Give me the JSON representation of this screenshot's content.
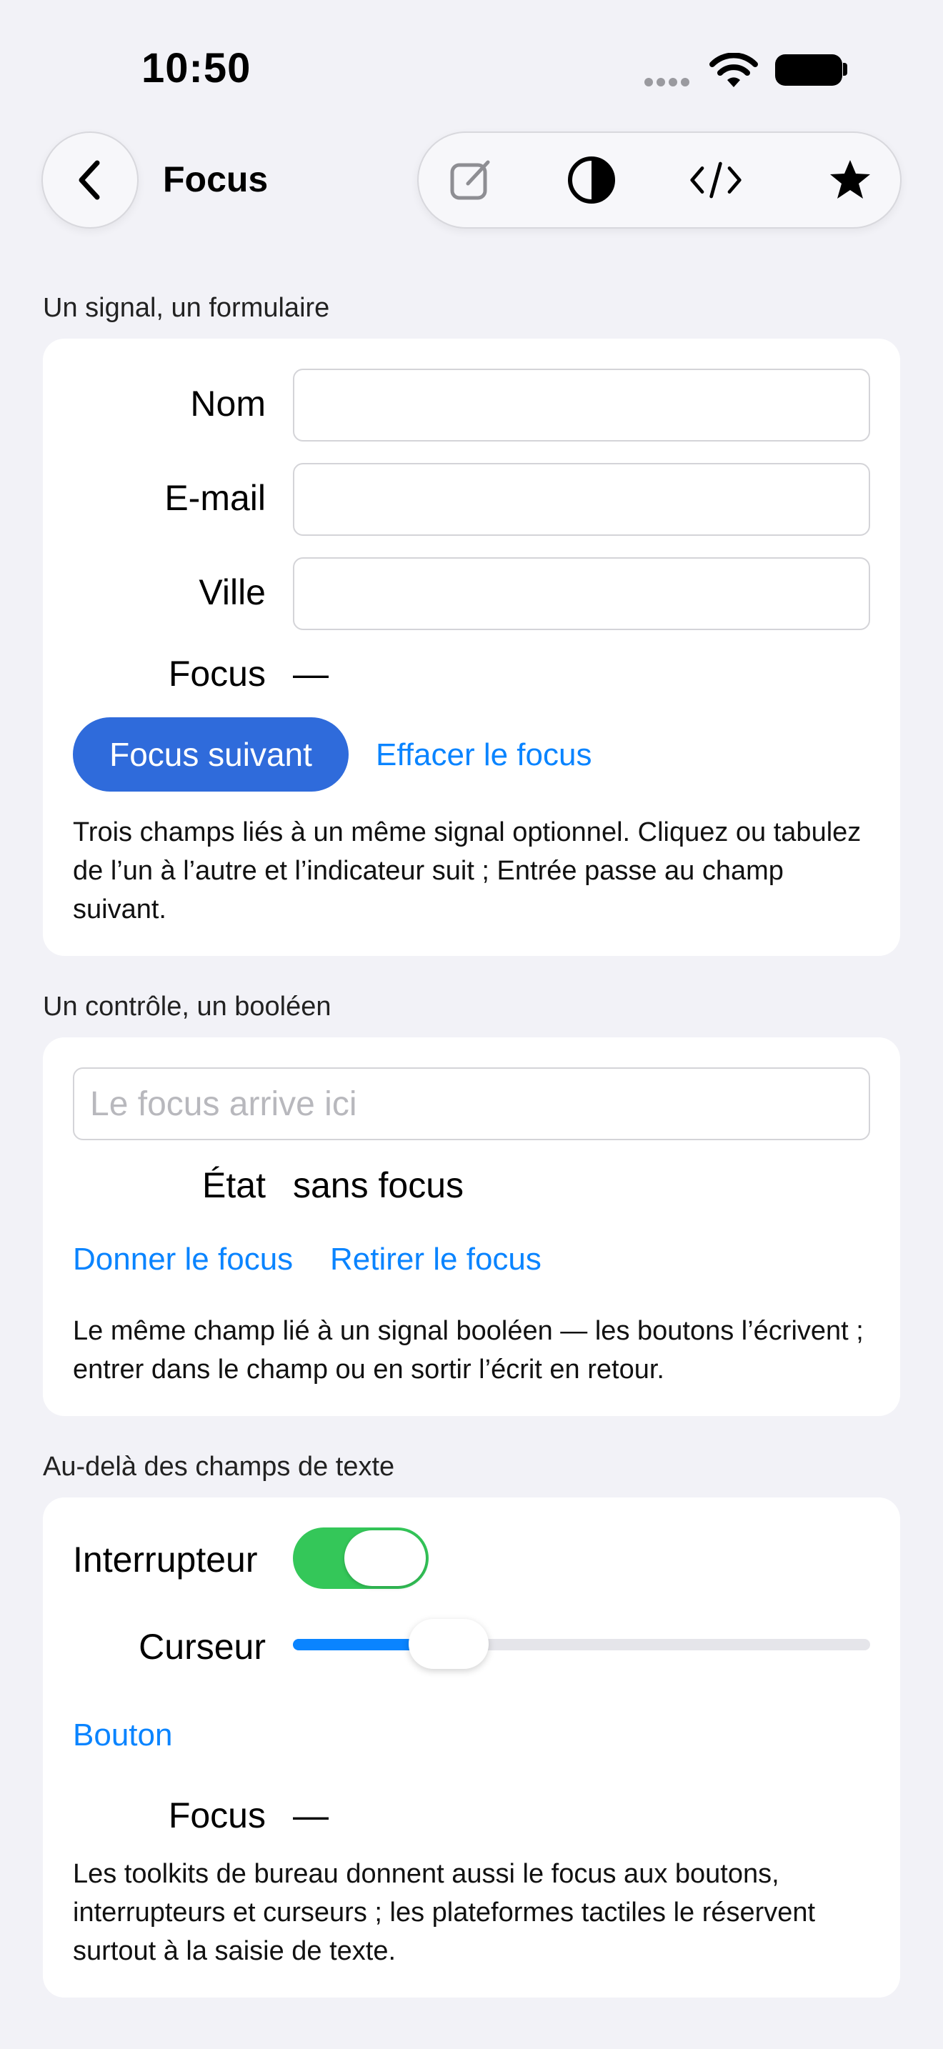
{
  "status_bar": {
    "time": "10:50"
  },
  "nav": {
    "title": "Focus",
    "toolbar_icons": [
      "compose-icon",
      "contrast-icon",
      "code-icon",
      "star-icon"
    ]
  },
  "section1": {
    "header": "Un signal, un formulaire",
    "name_label": "Nom",
    "email_label": "E-mail",
    "city_label": "Ville",
    "focus_label": "Focus",
    "focus_value": "—",
    "next_button": "Focus suivant",
    "clear_link": "Effacer le focus",
    "description": "Trois champs liés à un même signal optionnel. Cliquez ou tabulez de l’un à l’autre et l’indicateur suit ; Entrée passe au champ suivant."
  },
  "section2": {
    "header": "Un contrôle, un booléen",
    "field_placeholder": "Le focus arrive ici",
    "state_label": "État",
    "state_value": "sans focus",
    "give_link": "Donner le focus",
    "remove_link": "Retirer le focus",
    "description": "Le même champ lié à un signal booléen — les boutons l’écrivent ; entrer dans le champ ou en sortir l’écrit en retour."
  },
  "section3": {
    "header": "Au-delà des champs de texte",
    "switch_label": "Interrupteur",
    "switch_on": true,
    "slider_label": "Curseur",
    "slider_value": 0.27,
    "button_link": "Bouton",
    "focus_label": "Focus",
    "focus_value": "—",
    "description": "Les toolkits de bureau donnent aussi le focus aux boutons, interrupteurs et curseurs ; les plateformes tactiles le réservent surtout à la saisie de texte."
  },
  "colors": {
    "accent": "#0a84ff",
    "primary_button": "#2f6bdb",
    "switch_on": "#34c759",
    "background": "#f2f2f7"
  }
}
